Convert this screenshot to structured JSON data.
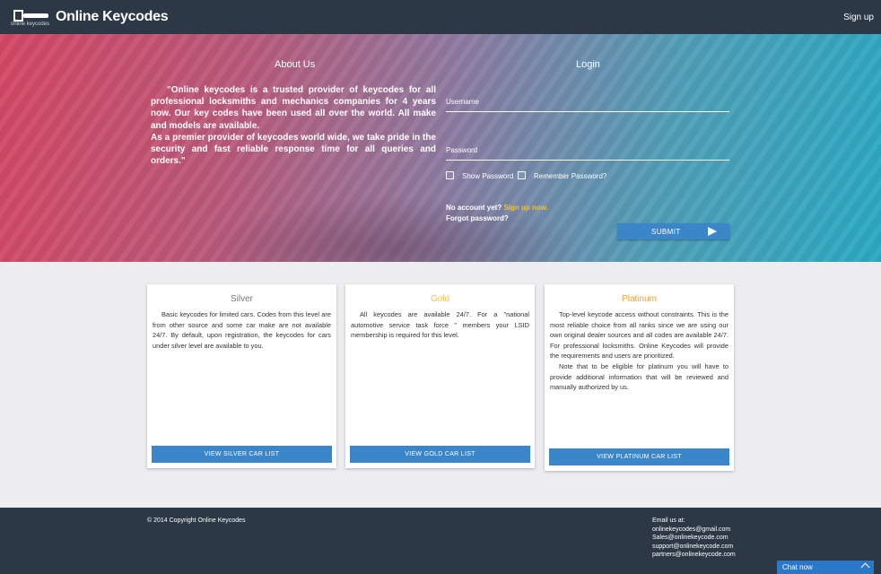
{
  "header": {
    "logo_text": "online keycodes",
    "brand": "Online Keycodes",
    "signup_label": "Sign up"
  },
  "about": {
    "title": "About Us",
    "paragraph1": "\"Online keycodes is a trusted provider of keycodes for all professional locksmiths and mechanics companies for 4 years now. Our key codes have been used all over the world. All make and models are available.",
    "paragraph2": "As a premier provider of keycodes world wide, we take pride in the security and fast reliable response time for all queries and orders.\""
  },
  "login": {
    "title": "Login",
    "username_label": "Username",
    "password_label": "Password",
    "show_password_label": "Show Password",
    "remember_password_label": "Remember Password?",
    "no_account_text": "No account yet?",
    "signup_link": "Sign up now.",
    "forgot_password": "Forgot password?",
    "submit_label": "SUBMIT"
  },
  "plans": [
    {
      "name": "Silver",
      "color": "#777777",
      "paragraphs": [
        "Basic keycodes for limited cars. Codes from this level are from other source and some car make are not available 24/7. By default, upon registration, the keycodes for cars under silver level are available to you."
      ],
      "button_label": "VIEW SILVER CAR LIST"
    },
    {
      "name": "Gold",
      "color": "#f2c25c",
      "paragraphs": [
        "All keycodes are available 24/7.  For a \"national automotive service task force \" members your LSID membership is required for this level."
      ],
      "button_label": "VIEW GOLD CAR LIST"
    },
    {
      "name": "Platinum",
      "color": "#e6a43c",
      "paragraphs": [
        "Top-level keycode access without constraints. This is the most reliable choice from all ranks since we are using our own original dealer sources and all codes are available 24/7. For professional locksmiths. Online Keycodes will provide the requirements and users are prioritized.",
        "Note that to be eligible for platinum you will have to provide additional information that will be reviewed and manually authorized by us."
      ],
      "button_label": "VIEW PLATINUM CAR LIST"
    }
  ],
  "footer": {
    "copyright": "© 2014 Copyright Online Keycodes",
    "email_heading": "Email us at:",
    "emails": [
      "onlinekeycodes@gmail.com",
      "Sales@onlinekeycode.com",
      "support@onlinekeycode.com",
      "partners@onlinekeycode.com"
    ]
  },
  "chat": {
    "label": "Chat now"
  }
}
